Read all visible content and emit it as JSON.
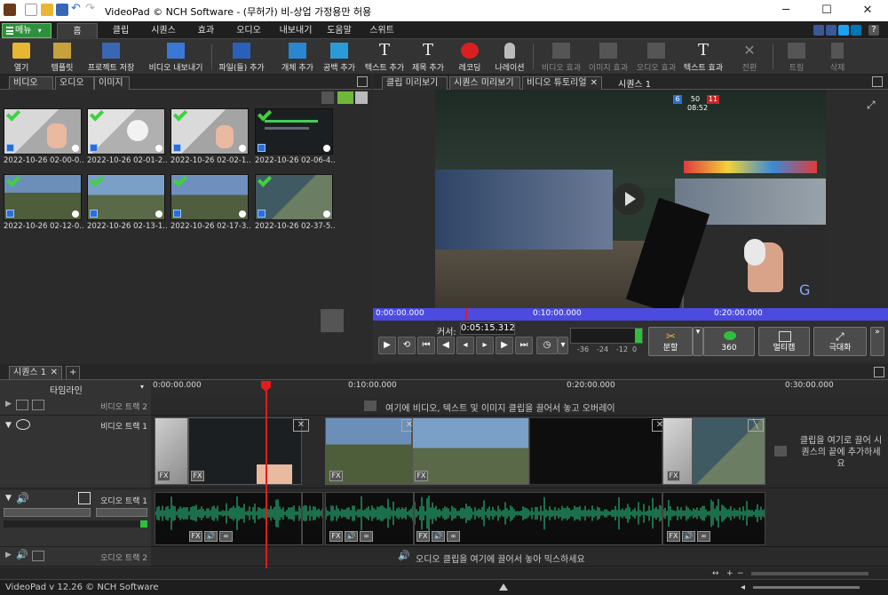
{
  "window": {
    "title": "VideoPad © NCH Software - (무허가) 비-상업 가정용만 허용",
    "minimize": "─",
    "maximize": "☐",
    "close": "✕"
  },
  "menu_tabs": {
    "menu_label": "메뉴",
    "tabs": [
      "홈",
      "클립",
      "시퀀스",
      "효과",
      "오디오",
      "내보내기",
      "도움말",
      "스위트"
    ]
  },
  "ribbon": {
    "buttons": [
      {
        "label": "열기"
      },
      {
        "label": "템플릿"
      },
      {
        "label": "프로젝트 저장"
      },
      {
        "label": "비디오 내보내기"
      },
      {
        "label": "파일(들) 추가"
      },
      {
        "label": "개체 추가"
      },
      {
        "label": "공백 추가"
      },
      {
        "label": "텍스트 추가"
      },
      {
        "label": "제목 추가"
      },
      {
        "label": "레코딩"
      },
      {
        "label": "나레이션"
      },
      {
        "label": "비디오 효과"
      },
      {
        "label": "이미지 효과"
      },
      {
        "label": "오디오 효과"
      },
      {
        "label": "텍스트 효과"
      },
      {
        "label": "전환"
      },
      {
        "label": "트림"
      },
      {
        "label": "삭제"
      }
    ]
  },
  "bin": {
    "tabs": [
      "비디오",
      "오디오",
      "이미지"
    ],
    "items": [
      {
        "caption": "2022-10-26 02-00-0..."
      },
      {
        "caption": "2022-10-26 02-01-2..."
      },
      {
        "caption": "2022-10-26 02-02-1..."
      },
      {
        "caption": "2022-10-26 02-06-4..."
      },
      {
        "caption": "2022-10-26 02-12-0..."
      },
      {
        "caption": "2022-10-26 02-13-1..."
      },
      {
        "caption": "2022-10-26 02-17-3..."
      },
      {
        "caption": "2022-10-26 02-37-5..."
      }
    ]
  },
  "preview": {
    "tabs": [
      "클립 미리보기",
      "시퀀스 미리보기",
      "비디오 튜토리얼"
    ],
    "sequence_label": "시퀀스 1",
    "hud_scores": [
      "6",
      "50",
      "11"
    ],
    "hud_time": "08:52",
    "ruler": [
      "0:00:00.000",
      "0:10:00.000",
      "0:20:00.000"
    ],
    "cursor_label": "커서:",
    "cursor_value": "0:05:15.312",
    "level_ticks": [
      "-36",
      "-24",
      "-12",
      "0"
    ],
    "split_label": "분할",
    "btn_360": "360",
    "multicam_label": "멀티캠",
    "maximize_label": "극대화"
  },
  "sequence": {
    "tab": "시퀀스 1",
    "add_tab": "+",
    "timeline_label": "타임라인",
    "ruler": [
      "0:00:00.000",
      "0:10:00.000",
      "0:20:00.000",
      "0:30:00.000"
    ],
    "tracks": {
      "video2": "비디오 트랙 2",
      "video1": "비디오 트랙 1",
      "audio1": "오디오 트랙 1",
      "audio2": "오디오 트랙 2"
    },
    "overlay_hint": "여기에 비디오, 텍스트 및 이미지 클립을 끌어서 놓고 오버레이",
    "end_hint": "클립을 여기로 끌어 시퀀스의 끝에 추가하세요",
    "audio_hint": "오디오 클립을 여기에 끌어서 놓아 믹스하세요",
    "fx": "FX"
  },
  "status": {
    "version": "VideoPad v 12.26 © NCH Software"
  }
}
